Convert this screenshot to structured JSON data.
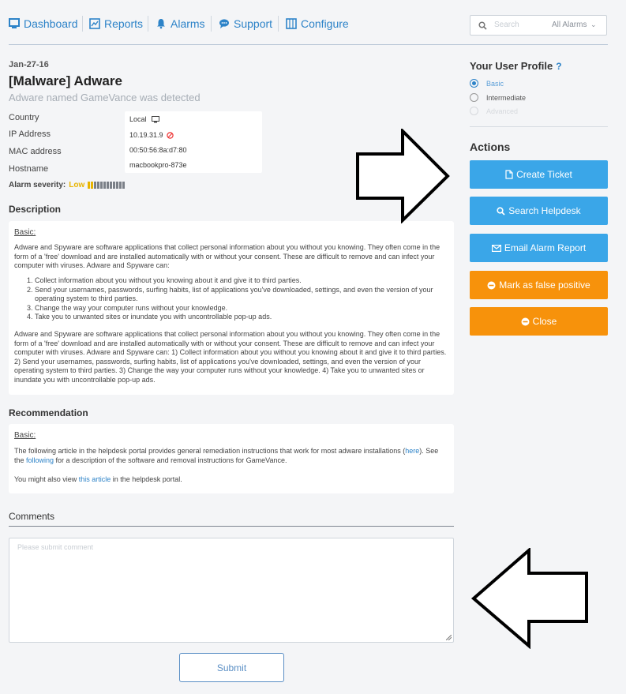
{
  "nav": {
    "items": [
      {
        "label": "Dashboard",
        "icon": "monitor-icon"
      },
      {
        "label": "Reports",
        "icon": "chart-icon"
      },
      {
        "label": "Alarms",
        "icon": "bell-icon"
      },
      {
        "label": "Support",
        "icon": "chat-icon"
      },
      {
        "label": "Configure",
        "icon": "grid-icon"
      }
    ],
    "search_placeholder": "Search",
    "filter_value": "All Alarms"
  },
  "alarm": {
    "date": "Jan-27-16",
    "title": "[Malware] Adware",
    "subtitle": "Adware named GameVance was detected",
    "fields": [
      {
        "label": "Country",
        "value": "Local"
      },
      {
        "label": "IP Address",
        "value": "10.19.31.9"
      },
      {
        "label": "MAC address",
        "value": "00:50:56:8a:d7:80"
      },
      {
        "label": "Hostname",
        "value": "macbookpro-873e"
      }
    ],
    "severity_label": "Alarm severity:",
    "severity_value": "Low",
    "severity_level": 2,
    "severity_max": 12
  },
  "description": {
    "heading": "Description",
    "basic": "Basic:",
    "intro": "Adware and Spyware are software applications that collect personal information about you without you knowing. They often come in the form of a 'free' download and are installed automatically with or without your consent. These are difficult to remove and can infect your computer with viruses. Adware and Spyware can:",
    "list": [
      "Collect information about you without you knowing about it and give it to third parties.",
      "Send your usernames, passwords, surfing habits, list of applications you've downloaded, settings, and even the version of your operating system to third parties.",
      "Change the way your computer runs without your knowledge.",
      "Take you to unwanted sites or inundate you with uncontrollable pop-up ads."
    ],
    "outro": "Adware and Spyware are software applications that collect personal information about you without you knowing. They often come in the form of a 'free' download and are installed automatically with or without your consent. These are difficult to remove and can infect your computer with viruses. Adware and Spyware can: 1) Collect information about you without you knowing about it and give it to third parties. 2) Send your usernames, passwords, surfing habits, list of applications you've downloaded, settings, and even the version of your operating system to third parties. 3) Change the way your computer runs without your knowledge. 4) Take you to unwanted sites or inundate you with uncontrollable pop-up ads."
  },
  "recommendation": {
    "heading": "Recommendation",
    "basic": "Basic:",
    "line1_a": "The following article in the helpdesk portal provides general remediation instructions that work for most adware installations (",
    "line1_link": "here",
    "line1_b": "). See the ",
    "line1_link2": "following",
    "line1_c": " for a description of the software and removal instructions for GameVance.",
    "line2_a": "You might also view ",
    "line2_link": "this article",
    "line2_b": " in the helpdesk portal."
  },
  "comments": {
    "heading": "Comments",
    "placeholder": "Please submit comment",
    "submit": "Submit"
  },
  "profile": {
    "title": "Your User Profile",
    "help": "?",
    "options": [
      {
        "label": "Basic",
        "state": "selected"
      },
      {
        "label": "Intermediate",
        "state": "normal"
      },
      {
        "label": "Advanced",
        "state": "disabled"
      }
    ]
  },
  "actions": {
    "title": "Actions",
    "buttons": [
      {
        "label": "Create Ticket",
        "icon": "file-icon",
        "color": "#3aa6e8"
      },
      {
        "label": "Search Helpdesk",
        "icon": "search-icon",
        "color": "#3aa6e8"
      },
      {
        "label": "Email Alarm Report",
        "icon": "envelope-icon",
        "color": "#3aa6e8"
      },
      {
        "label": "Mark as false positive",
        "icon": "minus-circle-icon",
        "color": "#f7920b"
      },
      {
        "label": "Close",
        "icon": "minus-circle-icon",
        "color": "#f7920b"
      }
    ]
  },
  "colors": {
    "accent": "#2d83c8",
    "action_blue": "#3aa6e8",
    "action_orange": "#f7920b",
    "severity": "#e8b400"
  }
}
